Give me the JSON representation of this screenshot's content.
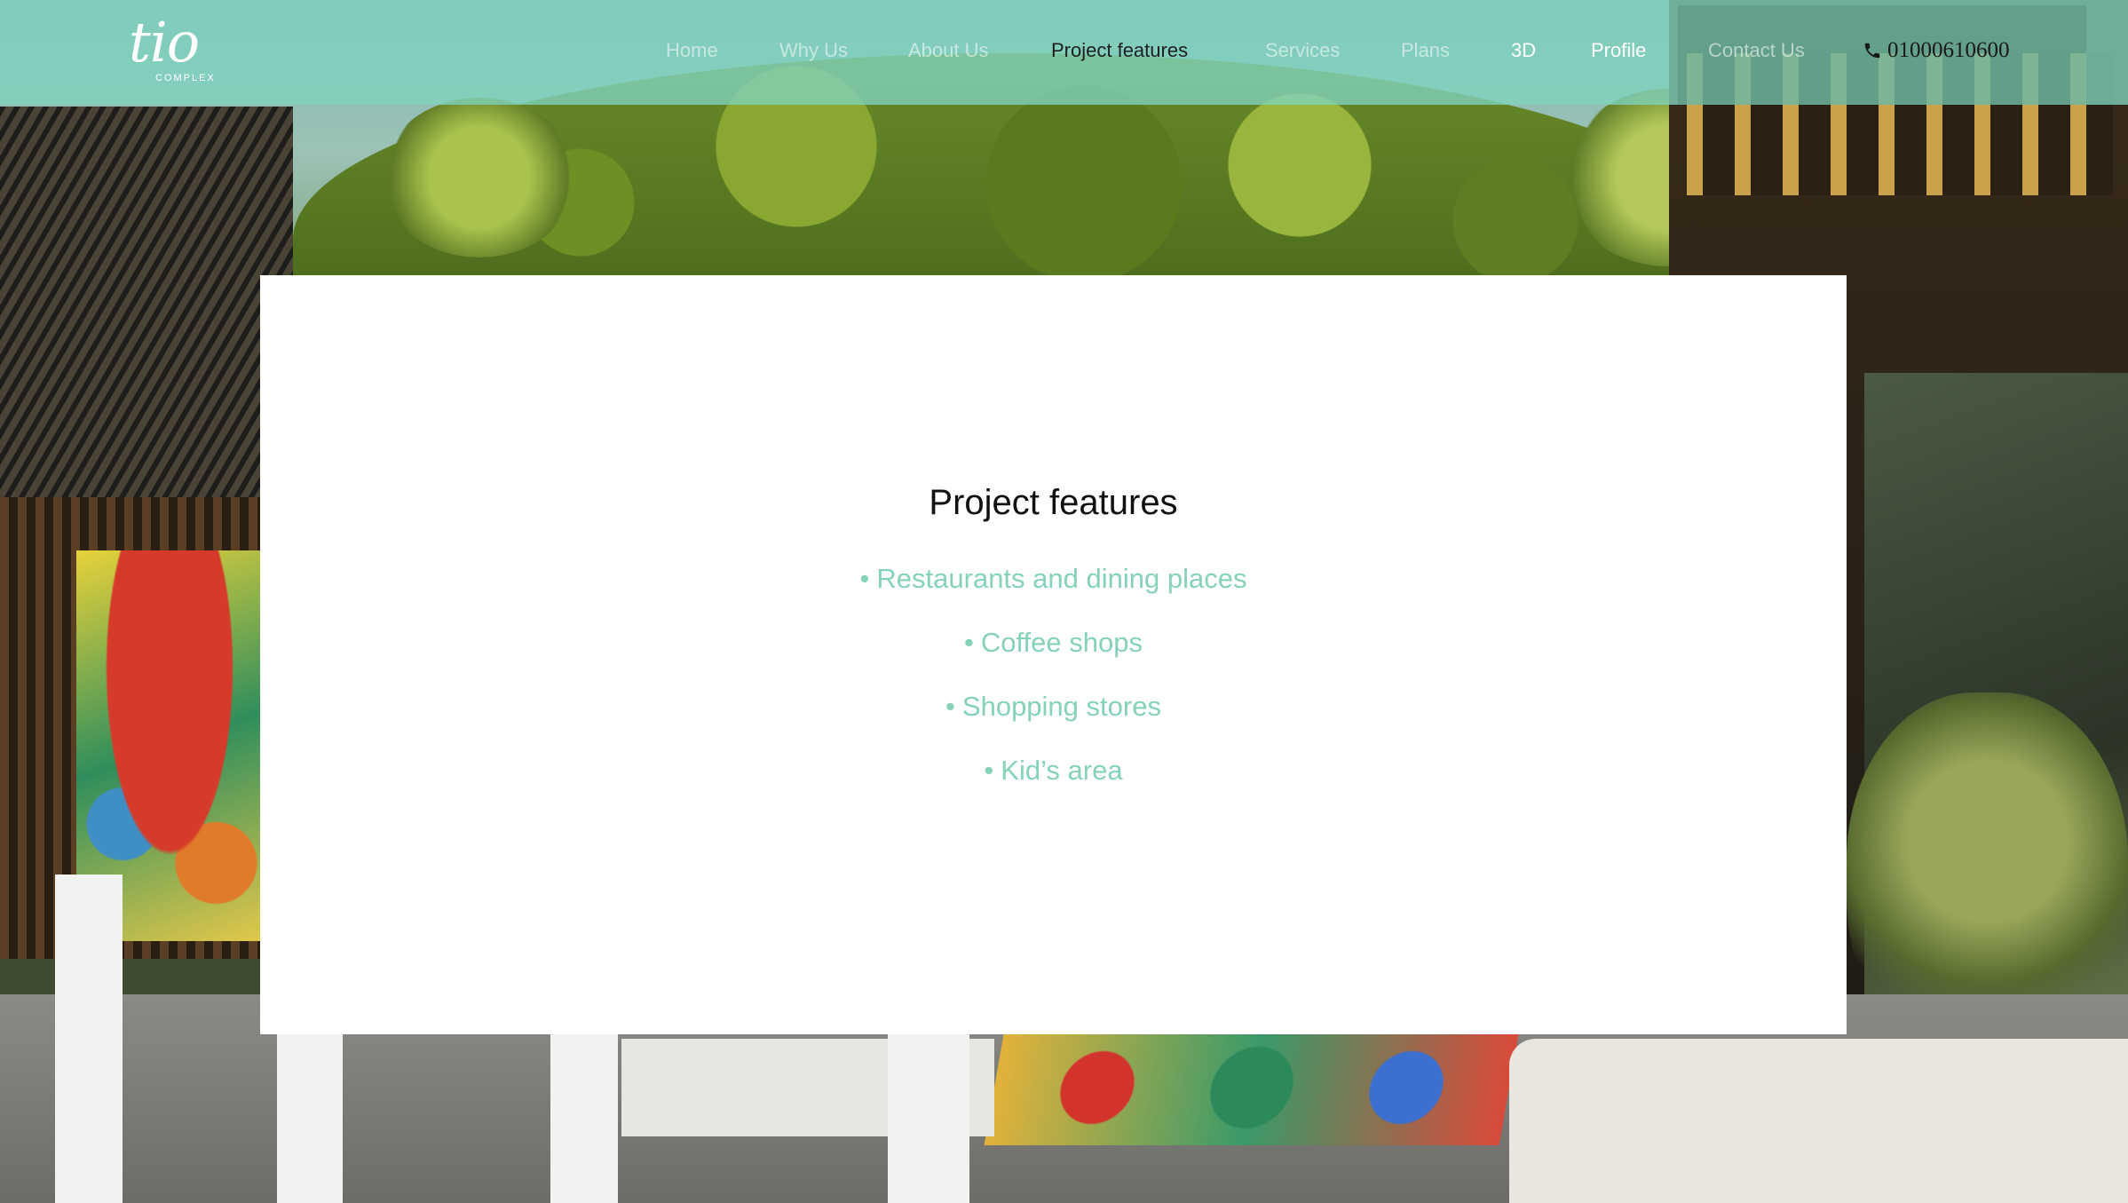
{
  "brand": {
    "logo_word": "tio",
    "logo_sub": "COMPLEX",
    "accent_color": "#86d2b8",
    "navbar_color": "#80d4be"
  },
  "nav": {
    "items": [
      {
        "label": "Home"
      },
      {
        "label": "Why Us"
      },
      {
        "label": "About Us"
      },
      {
        "label": "Project features",
        "active": true
      },
      {
        "label": "Services"
      },
      {
        "label": "Plans"
      },
      {
        "label": "3D"
      },
      {
        "label": "Profile"
      },
      {
        "label": "Contact Us"
      }
    ],
    "phone": "01000610600",
    "phone_icon": "phone-icon"
  },
  "main": {
    "title": "Project features",
    "features": [
      {
        "label": "Restaurants and dining places"
      },
      {
        "label": "Coffee shops"
      },
      {
        "label": "Shopping stores"
      },
      {
        "label": "Kid’s area"
      }
    ],
    "bullet": "•"
  }
}
